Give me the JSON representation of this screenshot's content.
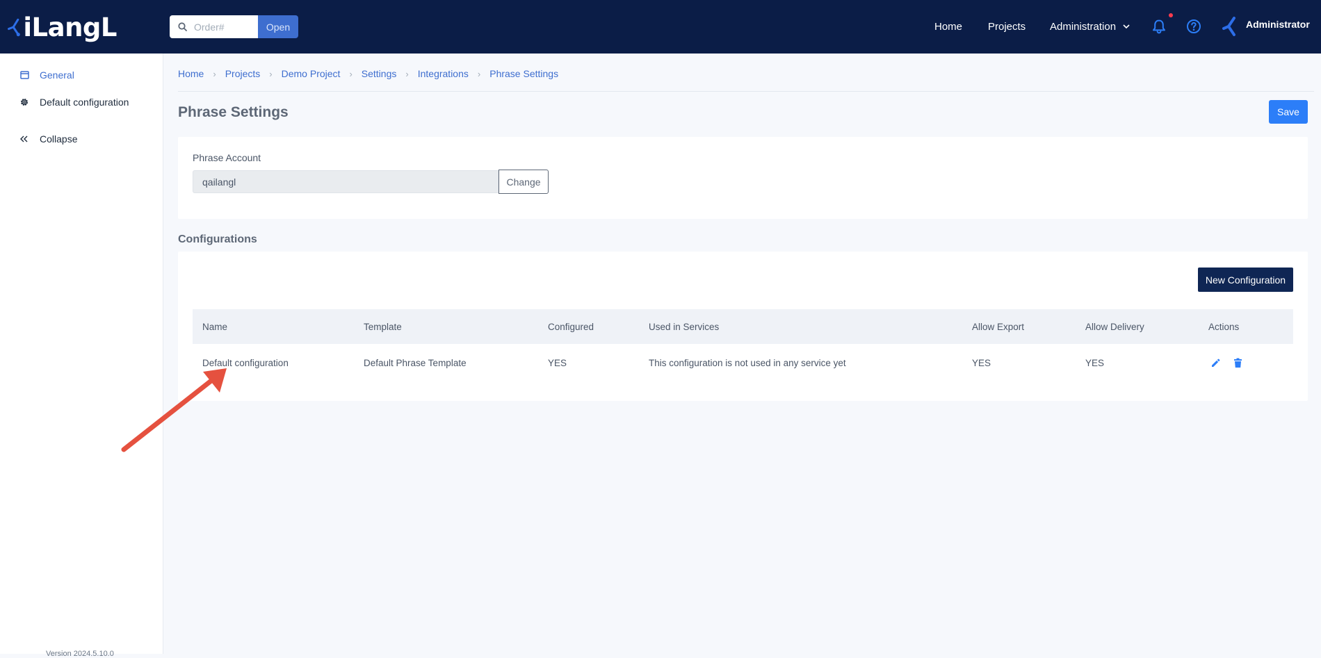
{
  "app": {
    "logo_text": "iLangL"
  },
  "topbar": {
    "search": {
      "placeholder": "Order#",
      "value": "",
      "icon": "search-icon",
      "open_label": "Open"
    },
    "nav": {
      "home": "Home",
      "projects": "Projects",
      "administration": "Administration"
    },
    "icons": {
      "notifications": "bell-icon",
      "help": "help-icon",
      "notification_dot_color": "#ff3b4e"
    },
    "user": {
      "name": "Administrator",
      "icon": "avatar-logo-icon"
    }
  },
  "sidebar": {
    "items": [
      {
        "label": "General",
        "icon": "window-icon",
        "active": true
      },
      {
        "label": "Default configuration",
        "icon": "gear-icon",
        "active": false
      },
      {
        "label": "Collapse",
        "icon": "double-chevron-left-icon",
        "active": false
      }
    ],
    "version": "Version 2024.5.10.0"
  },
  "breadcrumb": [
    "Home",
    "Projects",
    "Demo Project",
    "Settings",
    "Integrations",
    "Phrase Settings"
  ],
  "page": {
    "title": "Phrase Settings",
    "save_label": "Save"
  },
  "account": {
    "label": "Phrase Account",
    "value": "qailangl",
    "change_label": "Change"
  },
  "configurations": {
    "title": "Configurations",
    "new_label": "New Configuration",
    "columns": {
      "name": "Name",
      "template": "Template",
      "configured": "Configured",
      "used": "Used in Services",
      "export": "Allow Export",
      "delivery": "Allow Delivery",
      "actions": "Actions"
    },
    "rows": [
      {
        "name": "Default configuration",
        "template": "Default Phrase Template",
        "configured": "YES",
        "used": "This configuration is not used in any service yet",
        "export": "YES",
        "delivery": "YES"
      }
    ]
  },
  "colors": {
    "topbar": "#0b1d47",
    "accent": "#2c7ef8",
    "link": "#3e6ecf",
    "primary_dark": "#0f2654",
    "annotation_arrow": "#e5513f"
  }
}
